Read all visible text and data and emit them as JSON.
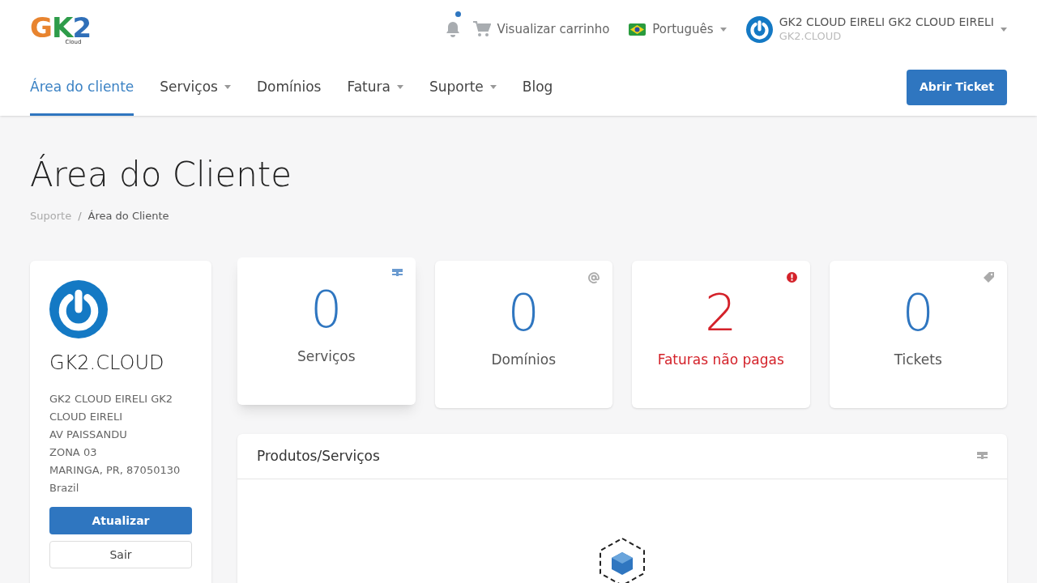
{
  "logo": {
    "text": "GK2",
    "subtitle": "Cloud"
  },
  "topbar": {
    "notifications": {
      "unread": true
    },
    "cart": "Visualizar carrinho",
    "language": "Português",
    "account": {
      "name": "GK2 CLOUD EIRELI GK2 CLOUD EIRELI",
      "company": "GK2.CLOUD"
    }
  },
  "nav": [
    {
      "label": "Área do cliente",
      "selected": true,
      "dropdown": false
    },
    {
      "label": "Serviços",
      "selected": false,
      "dropdown": true
    },
    {
      "label": "Domínios",
      "selected": false,
      "dropdown": false
    },
    {
      "label": "Fatura",
      "selected": false,
      "dropdown": true
    },
    {
      "label": "Suporte",
      "selected": false,
      "dropdown": true
    },
    {
      "label": "Blog",
      "selected": false,
      "dropdown": false
    }
  ],
  "open_ticket_button": "Abrir Ticket",
  "page_title": "Área do Cliente",
  "breadcrumb_separator": "/",
  "breadcrumb": [
    {
      "label": "Suporte",
      "current": false
    },
    {
      "label": "Área do Cliente",
      "current": true
    }
  ],
  "profile": {
    "name": "GK2.CLOUD",
    "address": [
      "GK2 CLOUD EIRELI GK2 CLOUD EIRELI",
      "AV PAISSANDU",
      "ZONA 03",
      "MARINGA, PR, 87050130",
      "Brazil"
    ],
    "buttons": [
      "Atualizar",
      "Sair"
    ]
  },
  "stats": [
    {
      "kind": "services",
      "count": "0",
      "label": "Serviços",
      "alert": false
    },
    {
      "kind": "domains",
      "count": "0",
      "label": "Domínios",
      "alert": false
    },
    {
      "kind": "invoices",
      "count": "2",
      "label": "Faturas não pagas",
      "alert": true
    },
    {
      "kind": "tickets",
      "count": "0",
      "label": "Tickets",
      "alert": false
    }
  ],
  "products_panel": {
    "title": "Produtos/Serviços"
  }
}
